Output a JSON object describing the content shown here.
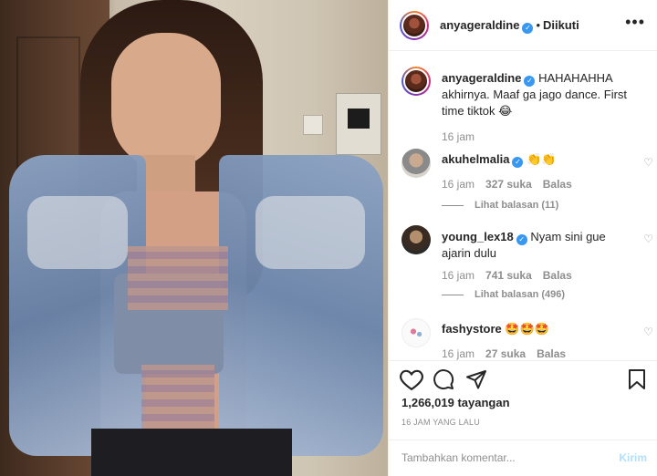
{
  "header": {
    "username": "anyageraldine",
    "follow_status": "Diikuti",
    "separator": "•"
  },
  "caption": {
    "username": "anyageraldine",
    "text": "HAHAHAHHA akhirnya. Maaf ga jago dance. First time tiktok 😂",
    "time": "16 jam"
  },
  "comments": [
    {
      "username": "akuhelmalia",
      "text": "👏👏",
      "time": "16 jam",
      "likes": "327 suka",
      "reply": "Balas",
      "view_replies": "Lihat balasan (11)"
    },
    {
      "username": "young_lex18",
      "text": "Nyam sini gue ajarin dulu",
      "time": "16 jam",
      "likes": "741 suka",
      "reply": "Balas",
      "view_replies": "Lihat balasan (496)"
    },
    {
      "username": "fashystore",
      "text": "🤩🤩🤩",
      "time": "16 jam",
      "likes": "27 suka",
      "reply": "Balas"
    }
  ],
  "footer": {
    "views": "1,266,019 tayangan",
    "posted": "16 JAM YANG LALU",
    "comment_placeholder": "Tambahkan komentar...",
    "post_label": "Kirim"
  },
  "icons": {
    "verified": "verified-badge-icon",
    "more": "more-options-icon",
    "like": "heart-icon",
    "comment": "comment-icon",
    "share": "paper-plane-icon",
    "save": "bookmark-icon"
  },
  "colors": {
    "verified": "#3897f0",
    "muted": "#8e8e8e",
    "post_button": "#b2dffc"
  }
}
